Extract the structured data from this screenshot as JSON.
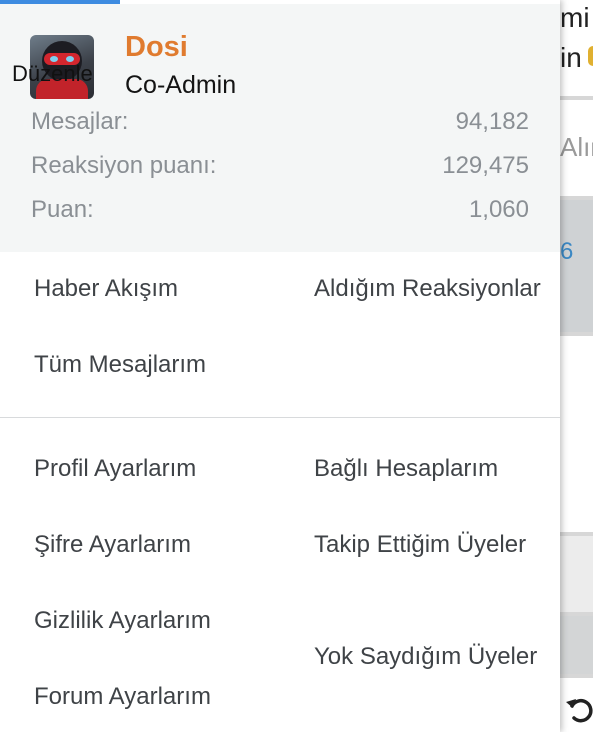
{
  "user": {
    "name": "Dosi",
    "title": "Co-Admin",
    "avatar_edit_label": "Düzenle"
  },
  "stats": [
    {
      "label": "Mesajlar:",
      "value": "94,182"
    },
    {
      "label": "Reaksiyon puanı:",
      "value": "129,475"
    },
    {
      "label": "Puan:",
      "value": "1,060"
    }
  ],
  "links_group1": [
    {
      "label": "Haber Akışım"
    },
    {
      "label": "Aldığım Reaksiyonlar"
    },
    {
      "label": "Tüm Mesajlarım"
    }
  ],
  "links_group2": [
    {
      "label": "Profil Ayarlarım"
    },
    {
      "label": "Bağlı Hesaplarım"
    },
    {
      "label": "Şifre Ayarlarım"
    },
    {
      "label": "Takip Ettiğim Üyeler"
    },
    {
      "label": "Gizlilik Ayarlarım"
    },
    {
      "label": "Yok Saydığım Üyeler"
    },
    {
      "label": "Forum Ayarlarım"
    }
  ],
  "background": {
    "line1": "mi",
    "line2": "in",
    "line3": "Alın",
    "line4": "6"
  },
  "colors": {
    "accent": "#3d8be0",
    "username": "#e07b2f",
    "card_bg": "#f4f6f6",
    "link_text": "#3f4347",
    "stat_text": "#8a8f94"
  },
  "icons": {
    "background_bottom": "undo-icon"
  }
}
